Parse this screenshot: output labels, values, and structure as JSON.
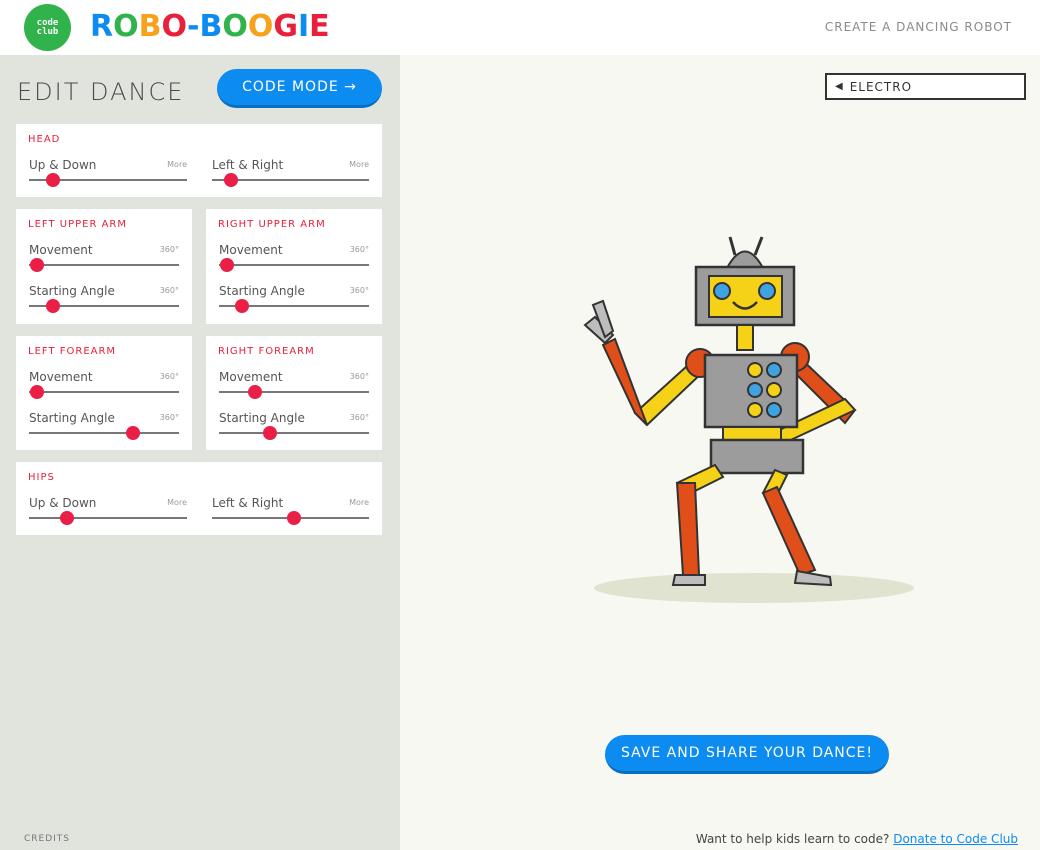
{
  "header": {
    "logo_line1": "code",
    "logo_line2": "club",
    "brand_letters": [
      {
        "ch": "R",
        "color": "#0c8bf0"
      },
      {
        "ch": "O",
        "color": "#2fb34a"
      },
      {
        "ch": "B",
        "color": "#f7a21b"
      },
      {
        "ch": "O",
        "color": "#e8203c"
      },
      {
        "ch": "-",
        "color": "#0c8bf0"
      },
      {
        "ch": "B",
        "color": "#0c8bf0"
      },
      {
        "ch": "O",
        "color": "#2fb34a"
      },
      {
        "ch": "O",
        "color": "#f7a21b"
      },
      {
        "ch": "G",
        "color": "#e8203c"
      },
      {
        "ch": "I",
        "color": "#0c8bf0"
      },
      {
        "ch": "E",
        "color": "#e8203c"
      }
    ],
    "tagline": "CREATE A DANCING ROBOT"
  },
  "left": {
    "title": "EDIT DANCE",
    "code_mode_label": "CODE MODE →",
    "credits": "CREDITS"
  },
  "sections": {
    "head": {
      "title": "HEAD",
      "updown_label": "Up & Down",
      "updown_note": "More",
      "updown_value": 0.15,
      "leftright_label": "Left & Right",
      "leftright_note": "More",
      "leftright_value": 0.12
    },
    "left_upper_arm": {
      "title": "LEFT UPPER ARM",
      "movement_label": "Movement",
      "movement_note": "360°",
      "movement_value": 0.05,
      "start_label": "Starting Angle",
      "start_note": "360°",
      "start_value": 0.16
    },
    "right_upper_arm": {
      "title": "RIGHT UPPER ARM",
      "movement_label": "Movement",
      "movement_note": "360°",
      "movement_value": 0.05,
      "start_label": "Starting Angle",
      "start_note": "360°",
      "start_value": 0.15
    },
    "left_forearm": {
      "title": "LEFT FOREARM",
      "movement_label": "Movement",
      "movement_note": "360°",
      "movement_value": 0.05,
      "start_label": "Starting Angle",
      "start_note": "360°",
      "start_value": 0.69
    },
    "right_forearm": {
      "title": "RIGHT FOREARM",
      "movement_label": "Movement",
      "movement_note": "360°",
      "movement_value": 0.24,
      "start_label": "Starting Angle",
      "start_note": "360°",
      "start_value": 0.34
    },
    "hips": {
      "title": "HIPS",
      "updown_label": "Up & Down",
      "updown_note": "More",
      "updown_value": 0.24,
      "leftright_label": "Left & Right",
      "leftright_note": "More",
      "leftright_value": 0.52
    }
  },
  "right": {
    "music_label": "ELECTRO",
    "save_label": "SAVE AND SHARE YOUR DANCE!",
    "donate_text": "Want to help kids learn to code?",
    "donate_link": "Donate to Code Club"
  },
  "colors": {
    "accent_blue": "#0c8bf0",
    "slider_red": "#ea1f48",
    "section_red": "#e8203c",
    "panel_bg": "#e1e4dd"
  }
}
